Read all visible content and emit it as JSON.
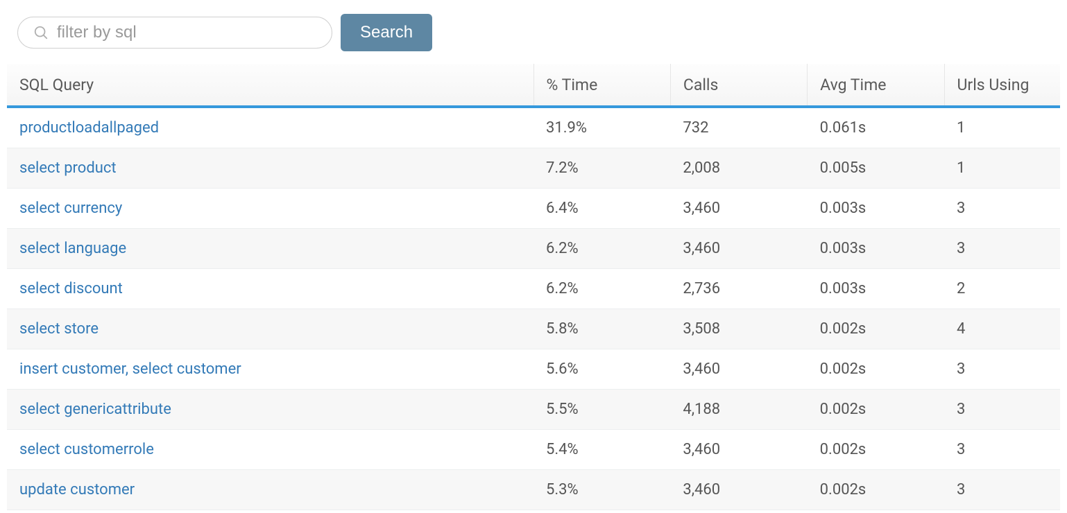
{
  "filter": {
    "placeholder": "filter by sql",
    "search_label": "Search"
  },
  "columns": {
    "query": "SQL Query",
    "pct": "% Time",
    "calls": "Calls",
    "avg": "Avg Time",
    "urls": "Urls Using"
  },
  "rows": [
    {
      "query": "productloadallpaged",
      "pct": "31.9%",
      "calls": "732",
      "avg": "0.061s",
      "urls": "1"
    },
    {
      "query": "select product",
      "pct": "7.2%",
      "calls": "2,008",
      "avg": "0.005s",
      "urls": "1"
    },
    {
      "query": "select currency",
      "pct": "6.4%",
      "calls": "3,460",
      "avg": "0.003s",
      "urls": "3"
    },
    {
      "query": "select language",
      "pct": "6.2%",
      "calls": "3,460",
      "avg": "0.003s",
      "urls": "3"
    },
    {
      "query": "select discount",
      "pct": "6.2%",
      "calls": "2,736",
      "avg": "0.003s",
      "urls": "2"
    },
    {
      "query": "select store",
      "pct": "5.8%",
      "calls": "3,508",
      "avg": "0.002s",
      "urls": "4"
    },
    {
      "query": "insert customer, select customer",
      "pct": "5.6%",
      "calls": "3,460",
      "avg": "0.002s",
      "urls": "3"
    },
    {
      "query": "select genericattribute",
      "pct": "5.5%",
      "calls": "4,188",
      "avg": "0.002s",
      "urls": "3"
    },
    {
      "query": "select customerrole",
      "pct": "5.4%",
      "calls": "3,460",
      "avg": "0.002s",
      "urls": "3"
    },
    {
      "query": "update customer",
      "pct": "5.3%",
      "calls": "3,460",
      "avg": "0.002s",
      "urls": "3"
    }
  ]
}
